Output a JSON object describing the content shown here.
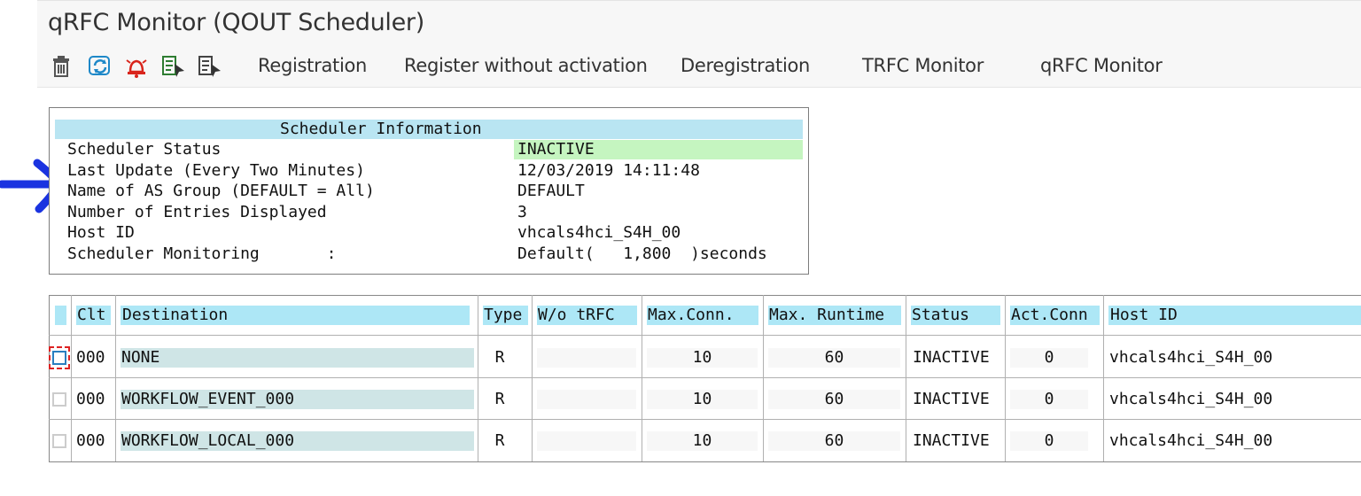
{
  "window": {
    "title": "qRFC Monitor (QOUT Scheduler)"
  },
  "toolbar": {
    "icons": [
      "trash-icon",
      "refresh-icon",
      "alarm-bell-icon",
      "select-pointer-icon",
      "details-pointer-icon"
    ],
    "buttons": [
      "Registration",
      "Register without activation",
      "Deregistration",
      "TRFC Monitor",
      "qRFC Monitor"
    ]
  },
  "scheduler_info": {
    "heading": "Scheduler Information",
    "rows": [
      {
        "label": "Scheduler Status",
        "value": "INACTIVE"
      },
      {
        "label": "Last Update (Every Two Minutes)",
        "value": "12/03/2019 14:11:48"
      },
      {
        "label": "Name of AS Group (DEFAULT = All)",
        "value": "DEFAULT"
      },
      {
        "label": "Number of Entries Displayed",
        "value": "3"
      },
      {
        "label": "Host ID",
        "value": "vhcals4hci_S4H_00"
      },
      {
        "label": "Scheduler Monitoring       :",
        "value": "Default(   1,800  )seconds"
      }
    ]
  },
  "table": {
    "columns": [
      "Clt",
      "Destination",
      "Type",
      "W/o tRFC",
      "Max.Conn.",
      "Max. Runtime",
      "Status",
      "Act.Conn",
      "Host ID"
    ],
    "rows": [
      {
        "clt": "000",
        "destination": "NONE",
        "type": "R",
        "wo_trfc": "",
        "max_conn": "10",
        "max_runtime": "60",
        "status": "INACTIVE",
        "act_conn": "0",
        "host_id": "vhcals4hci_S4H_00"
      },
      {
        "clt": "000",
        "destination": "WORKFLOW_EVENT_000",
        "type": "R",
        "wo_trfc": "",
        "max_conn": "10",
        "max_runtime": "60",
        "status": "INACTIVE",
        "act_conn": "0",
        "host_id": "vhcals4hci_S4H_00"
      },
      {
        "clt": "000",
        "destination": "WORKFLOW_LOCAL_000",
        "type": "R",
        "wo_trfc": "",
        "max_conn": "10",
        "max_runtime": "60",
        "status": "INACTIVE",
        "act_conn": "0",
        "host_id": "vhcals4hci_S4H_00"
      }
    ]
  },
  "colors": {
    "header_cell": "#ade7f6",
    "info_heading": "#b9e5f2",
    "status_inactive_bg": "#c5f5c0",
    "destination_cell": "#cfe5e6",
    "annotation_arrow": "#1a33e0"
  }
}
